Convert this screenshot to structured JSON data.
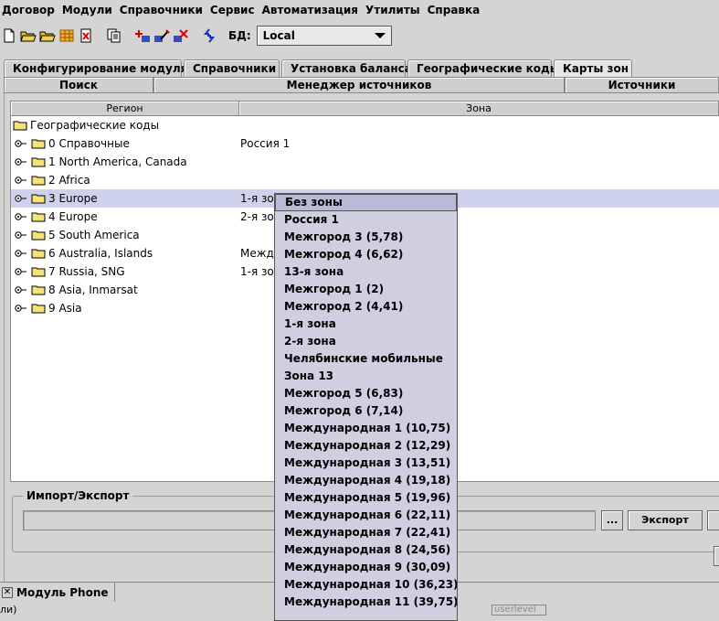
{
  "menu": [
    "Договор",
    "Модули",
    "Справочники",
    "Сервис",
    "Автоматизация",
    "Утилиты",
    "Справка"
  ],
  "toolbar": {
    "icons": [
      "new-icon",
      "open-folder-icon",
      "open-folder-icon",
      "table-icon",
      "delete-icon",
      "copy-icon",
      "add-icon",
      "edit-icon",
      "remove-icon",
      "refresh-icon"
    ],
    "db_label": "БД:",
    "db_value": "Local"
  },
  "tabs_row1": [
    "Конфигурирование модуля",
    "Справочники",
    "Установка баланса",
    "Географические коды",
    "Карты зон"
  ],
  "tabs_row2": [
    "Поиск",
    "Менеджер источников",
    "Источники"
  ],
  "table": {
    "columns": [
      "Регион",
      "Зона"
    ],
    "root": "Географические коды",
    "rows": [
      {
        "region": "0 Справочные",
        "zone": "Россия 1"
      },
      {
        "region": "1 North America, Canada",
        "zone": ""
      },
      {
        "region": "2 Africa",
        "zone": ""
      },
      {
        "region": "3 Europe",
        "zone": "1-я зо"
      },
      {
        "region": "4 Europe",
        "zone": "2-я зо"
      },
      {
        "region": "5 South America",
        "zone": ""
      },
      {
        "region": "6 Australia, Islands",
        "zone": "Между"
      },
      {
        "region": "7 Russia, SNG",
        "zone": "1-я зо"
      },
      {
        "region": "8 Asia, Inmarsat",
        "zone": ""
      },
      {
        "region": "9 Asia",
        "zone": ""
      }
    ]
  },
  "popup": {
    "items": [
      "Без зоны",
      "Россия 1",
      "Межгород 3 (5,78)",
      "Межгород 4 (6,62)",
      "13-я зона",
      "Межгород 1 (2)",
      "Межгород 2 (4,41)",
      "1-я зона",
      "2-я зона",
      "Челябинские мобильные",
      "Зона 13",
      "Межгород 5 (6,83)",
      "Межгород 6 (7,14)",
      "Международная 1 (10,75)",
      "Международная 2 (12,29)",
      "Международная 3 (13,51)",
      "Международная 4 (19,18)",
      "Международная 5 (19,96)",
      "Международная 6 (22,11)",
      "Международная 7 (22,41)",
      "Международная 8 (24,56)",
      "Международная 9 (30,09)",
      "Международная 10 (36,23)",
      "Международная 11 (39,75)"
    ]
  },
  "import_export": {
    "legend": "Импорт/Экспорт",
    "browse_label": "...",
    "export_label": "Экспорт"
  },
  "bottom": {
    "module_tab": "Модуль Phone",
    "close_glyph": "✕",
    "status_left": "ли)",
    "status_field": "userlevel"
  },
  "colors": {
    "background": "#d4d4d4",
    "selected_row": "#cfd2ec",
    "popup_bg": "#cfcfe0",
    "popup_highlight": "#b8bad8"
  }
}
